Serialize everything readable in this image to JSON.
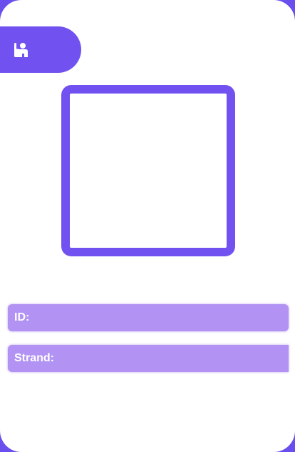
{
  "header": {
    "icon": "person-raising-hand-icon"
  },
  "fields": {
    "id_label": "ID:",
    "strand_label": "Strand:"
  },
  "colors": {
    "accent": "#7152f0",
    "field_background": "#b293f3",
    "card_background": "#ffffff"
  }
}
